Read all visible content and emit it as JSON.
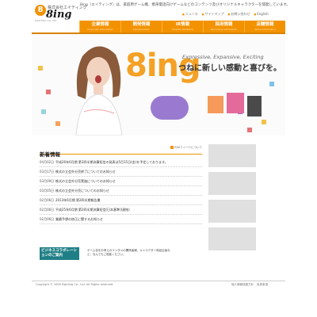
{
  "header": {
    "company_label": "株式会社エイティング",
    "logo_word": "8ing",
    "logo_sub": "EIGHTING CO.,LTD.",
    "tagline": "8ing（エイティング）は、家庭用ゲーム機、携帯電話向けゲームなどのコンテンツ及びオリジナルキャラクターを開発しています。",
    "top_links": [
      "ニュース",
      "サイトマップ",
      "お問い合わせ",
      "English"
    ]
  },
  "nav": [
    {
      "label": "企業情報",
      "sub": "Corporate Information"
    },
    {
      "label": "開発情報",
      "sub": "Development"
    },
    {
      "label": "IR情報",
      "sub": "Investor Relations"
    },
    {
      "label": "採用情報",
      "sub": "Recruiting Information"
    },
    {
      "label": "店舗情報",
      "sub": "Store Information"
    }
  ],
  "hero": {
    "en_tagline": "Expressive, Expansive, Exciting",
    "jp_tagline": "つねに新しい感動と喜びを。",
    "brand": "8ing"
  },
  "news": {
    "title": "新着情報",
    "rss_label": "RSSフィードについて",
    "items": [
      {
        "date": "04月02日",
        "text": "平成26年6月期 第3四半期決算短信の発表は5月15日(金)を予定しております。"
      },
      {
        "date": "03月17日",
        "text": "株式の立会外分売終了についてのお知らせ"
      },
      {
        "date": "03月09日",
        "text": "株式の立会外分売実施についてのお知らせ"
      },
      {
        "date": "03月05日",
        "text": "株式の立会外分売についてのお知らせ"
      },
      {
        "date": "02月06日",
        "text": "2013年6月期 第2四半期報告書"
      },
      {
        "date": "02月06日",
        "text": "平成25年6月期 第2四半期決算短信[日本基準](連結)"
      },
      {
        "date": "02月06日",
        "text": "業績予想の修正に関するお知らせ"
      }
    ]
  },
  "business": {
    "button": "ビジネスコラボレーションのご案内",
    "text": "ゲーム化をお考えのエンタメの関係者様、キャラクター商品企画など、なんでもご相談ください。"
  },
  "footer": {
    "copyright": "Copyright © 2006 Eighting Co., Ltd. All Rights reserved.",
    "links": [
      "個人情報保護方針",
      "免責事項"
    ]
  },
  "colors": {
    "accent": "#f39200",
    "teal": "#1f7f86"
  }
}
